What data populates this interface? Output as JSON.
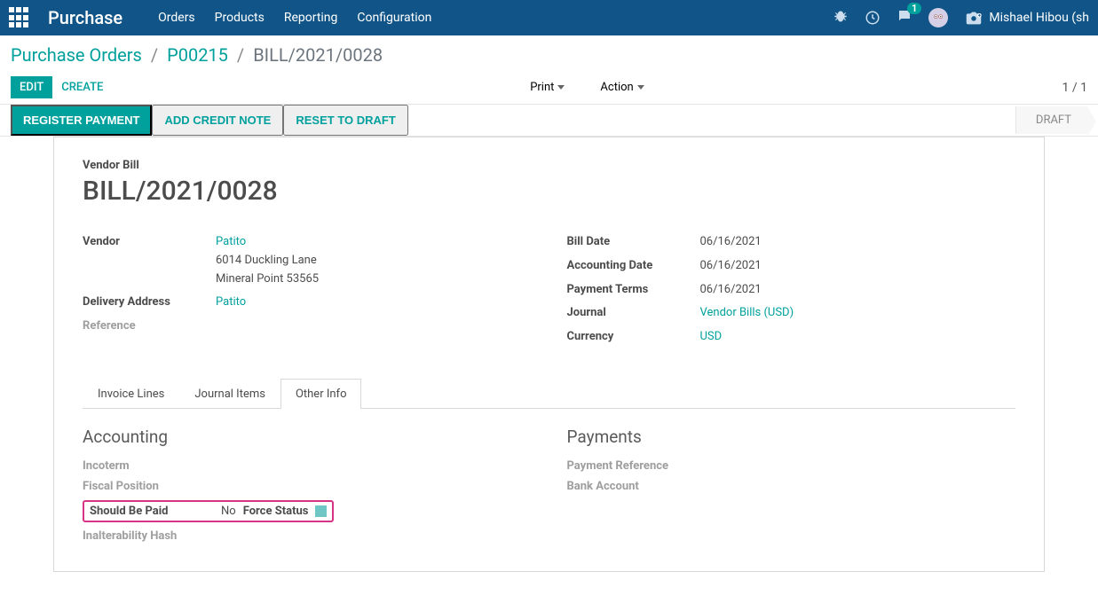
{
  "navbar": {
    "app_name": "Purchase",
    "menu": [
      "Orders",
      "Products",
      "Reporting",
      "Configuration"
    ],
    "chat_count": "1",
    "user_name": "Mishael Hibou (sh"
  },
  "breadcrumb": {
    "items": [
      {
        "label": "Purchase Orders",
        "link": true
      },
      {
        "label": "P00215",
        "link": true
      },
      {
        "label": "BILL/2021/0028",
        "link": false
      }
    ]
  },
  "control": {
    "edit": "EDIT",
    "create": "CREATE",
    "print": "Print",
    "action": "Action",
    "pager": "1 / 1"
  },
  "actions": {
    "register_payment": "REGISTER PAYMENT",
    "add_credit_note": "ADD CREDIT NOTE",
    "reset_to_draft": "RESET TO DRAFT",
    "status": "DRAFT"
  },
  "document": {
    "type_label": "Vendor Bill",
    "title": "BILL/2021/0028",
    "left_fields": {
      "vendor_label": "Vendor",
      "vendor_name": "Patito",
      "vendor_addr1": "6014 Duckling Lane",
      "vendor_addr2": "Mineral Point 53565",
      "delivery_label": "Delivery Address",
      "delivery_value": "Patito",
      "reference_label": "Reference"
    },
    "right_fields": {
      "bill_date_label": "Bill Date",
      "bill_date": "06/16/2021",
      "accounting_date_label": "Accounting Date",
      "accounting_date": "06/16/2021",
      "payment_terms_label": "Payment Terms",
      "payment_terms": "06/16/2021",
      "journal_label": "Journal",
      "journal": "Vendor Bills (USD)",
      "currency_label": "Currency",
      "currency": "USD"
    }
  },
  "tabs": {
    "invoice_lines": "Invoice Lines",
    "journal_items": "Journal Items",
    "other_info": "Other Info"
  },
  "other_info": {
    "accounting_heading": "Accounting",
    "incoterm_label": "Incoterm",
    "fiscal_position_label": "Fiscal Position",
    "should_be_paid_label": "Should Be Paid",
    "should_be_paid_value": "No",
    "force_status_label": "Force Status",
    "inalterability_label": "Inalterability Hash",
    "payments_heading": "Payments",
    "payment_reference_label": "Payment Reference",
    "bank_account_label": "Bank Account"
  }
}
